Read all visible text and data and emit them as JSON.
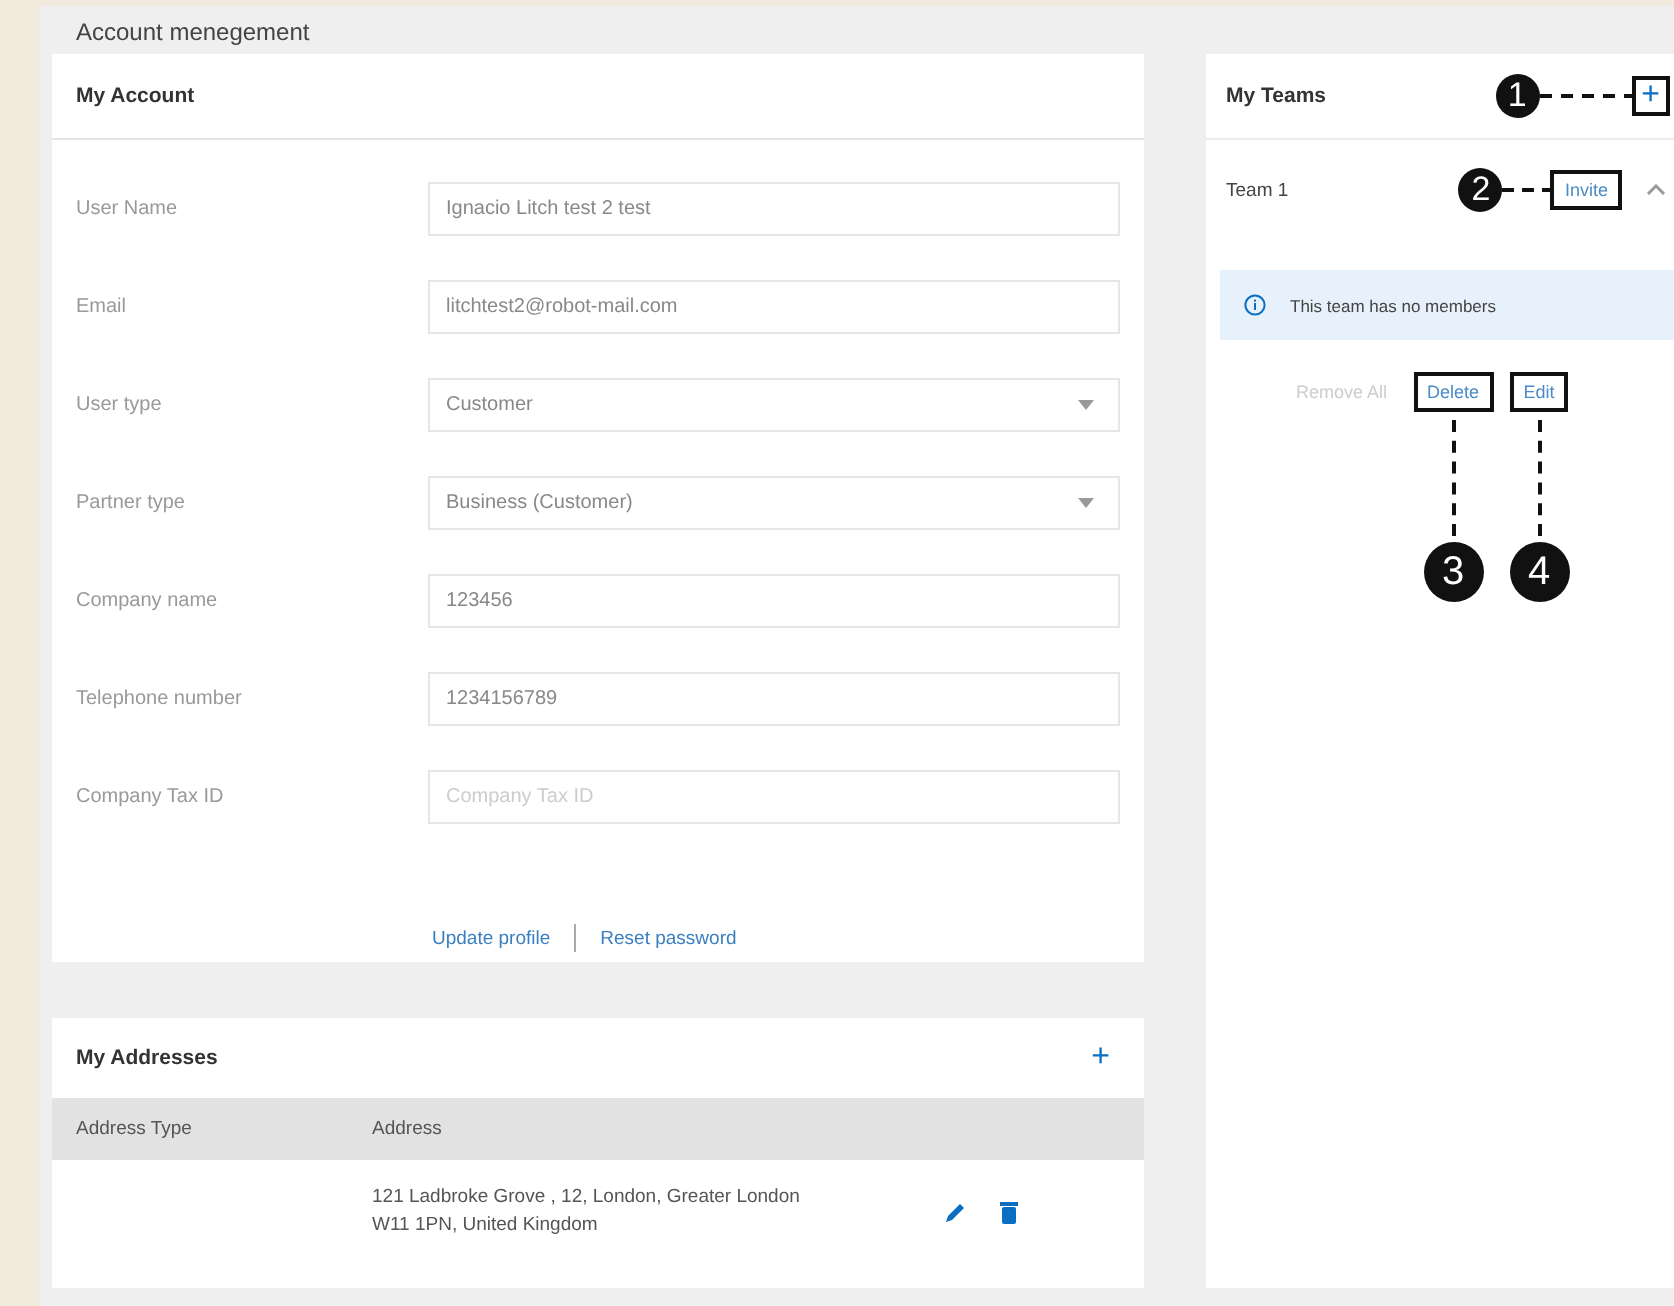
{
  "page_title": "Account menegement",
  "account": {
    "title": "My Account",
    "fields": [
      {
        "label": "User Name",
        "kind": "text",
        "value": "Ignacio Litch test 2 test"
      },
      {
        "label": "Email",
        "kind": "text",
        "value": "litchtest2@robot-mail.com"
      },
      {
        "label": "User type",
        "kind": "select",
        "value": "Customer"
      },
      {
        "label": "Partner type",
        "kind": "select",
        "value": "Business (Customer)"
      },
      {
        "label": "Company name",
        "kind": "text",
        "value": "123456"
      },
      {
        "label": "Telephone number",
        "kind": "text",
        "value": "1234156789"
      },
      {
        "label": "Company Tax ID",
        "kind": "text",
        "placeholder": "Company Tax ID"
      }
    ],
    "links": [
      "Update profile",
      "Reset password"
    ]
  },
  "addresses": {
    "title": "My Addresses",
    "add_button": "+",
    "columns": [
      "Address Type",
      "Address"
    ],
    "rows": [
      {
        "address_type": "",
        "address_lines": [
          "121 Ladbroke Grove , 12, London, Greater London",
          "W11 1PN, United Kingdom"
        ]
      }
    ]
  },
  "teams": {
    "title": "My Teams",
    "add_button": {
      "label": "+",
      "callout": "1"
    },
    "items": [
      {
        "name": "Team 1",
        "expanded": true,
        "invite": {
          "label": "Invite",
          "callout": "2"
        },
        "notice": "This team has no members",
        "actions": [
          {
            "label": "Remove All",
            "disabled": true
          },
          {
            "label": "Delete",
            "disabled": false,
            "callout": "3"
          },
          {
            "label": "Edit",
            "disabled": false,
            "callout": "4"
          }
        ]
      }
    ]
  }
}
